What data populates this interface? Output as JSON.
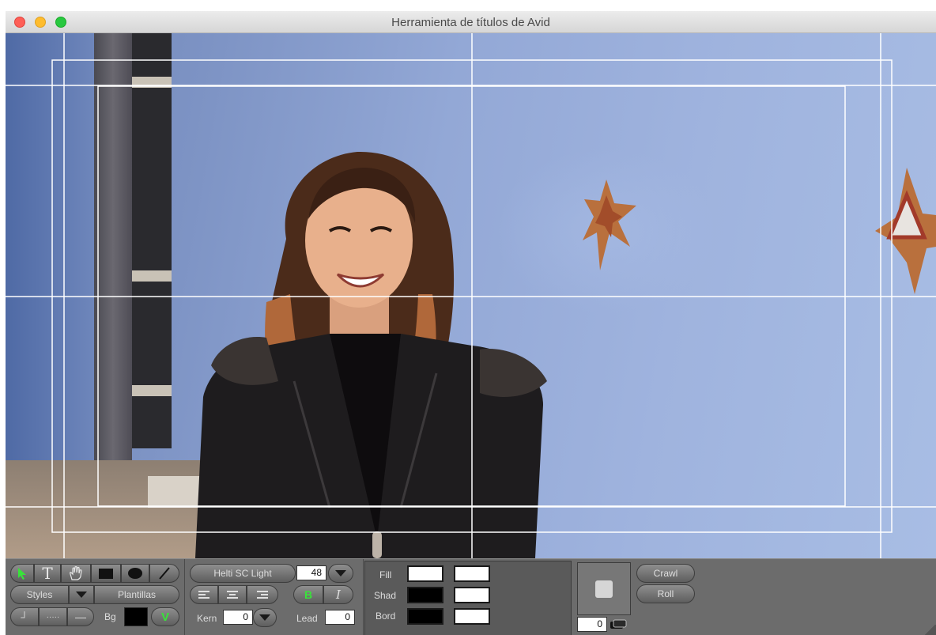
{
  "window": {
    "title": "Herramienta de títulos de Avid"
  },
  "tools": {
    "select_icon": "arrow-icon",
    "text_tool_glyph": "T",
    "hand_icon": "hand-icon",
    "rect_icon": "rectangle-icon",
    "oval_icon": "oval-icon",
    "line_icon": "line-icon"
  },
  "styles": {
    "label": "Styles",
    "templates_label": "Plantillas"
  },
  "line_buttons": {
    "corner_glyph": "┘",
    "dotted_glyph": "·····",
    "solid_glyph": "—"
  },
  "background": {
    "label": "Bg",
    "color": "#000000",
    "v_label": "V"
  },
  "font": {
    "name": "Helti SC Light",
    "size": "48"
  },
  "align": {
    "left_icon": "align-left-icon",
    "center_icon": "align-center-icon",
    "right_icon": "align-right-icon"
  },
  "style_toggles": {
    "bold": "B",
    "italic": "I"
  },
  "kern": {
    "label": "Kern",
    "value": "0"
  },
  "lead": {
    "label": "Lead",
    "value": "0"
  },
  "colors": {
    "fill_label": "Fill",
    "shad_label": "Shad",
    "bord_label": "Bord",
    "fill_color": "#ffffff",
    "fill_alt_color": "#ffffff",
    "shad_color": "#000000",
    "shad_alt_color": "#ffffff",
    "bord_color": "#000000",
    "bord_alt_color": "#ffffff"
  },
  "depth": {
    "value": "0"
  },
  "motion": {
    "crawl": "Crawl",
    "roll": "Roll"
  }
}
